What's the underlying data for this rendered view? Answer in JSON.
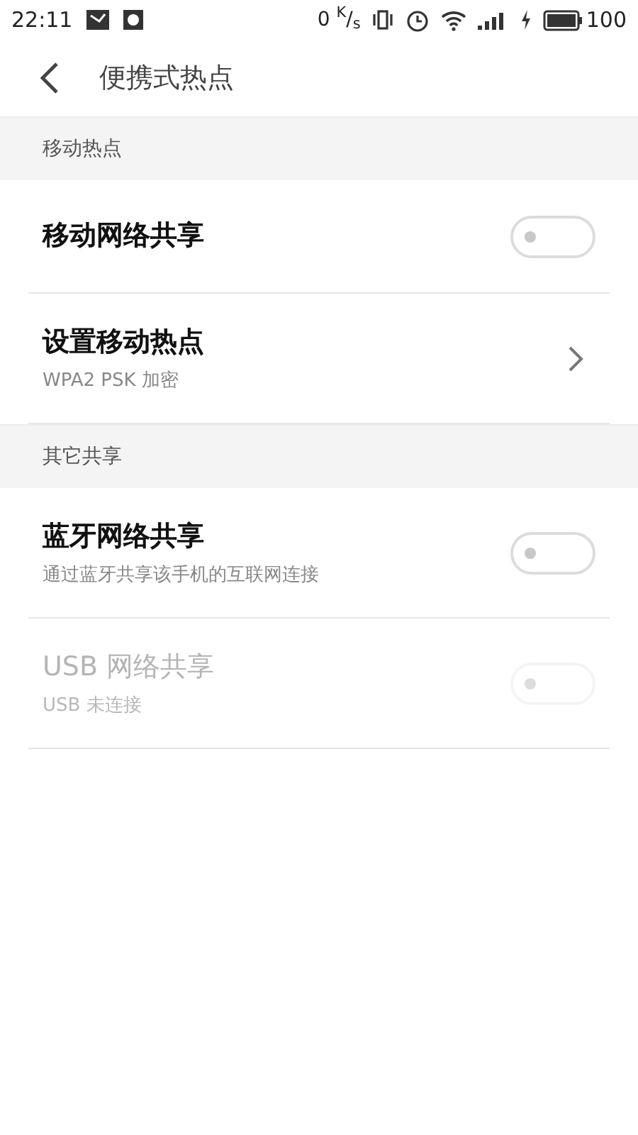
{
  "status_bar": {
    "time": "22:11",
    "speed": "0 $^{K}$/$_{s}$",
    "battery": "100"
  },
  "header": {
    "title": "便携式热点"
  },
  "sections": [
    {
      "title": "移动热点",
      "items": [
        {
          "kind": "toggle",
          "title": "移动网络共享",
          "on": false,
          "disabled": false
        },
        {
          "kind": "link",
          "title": "设置移动热点",
          "subtitle": "WPA2 PSK 加密",
          "disabled": false
        }
      ]
    },
    {
      "title": "其它共享",
      "items": [
        {
          "kind": "toggle",
          "title": "蓝牙网络共享",
          "subtitle": "通过蓝牙共享该手机的互联网连接",
          "on": false,
          "disabled": false
        },
        {
          "kind": "toggle",
          "title": "USB 网络共享",
          "subtitle": "USB 未连接",
          "on": false,
          "disabled": true
        }
      ]
    }
  ]
}
